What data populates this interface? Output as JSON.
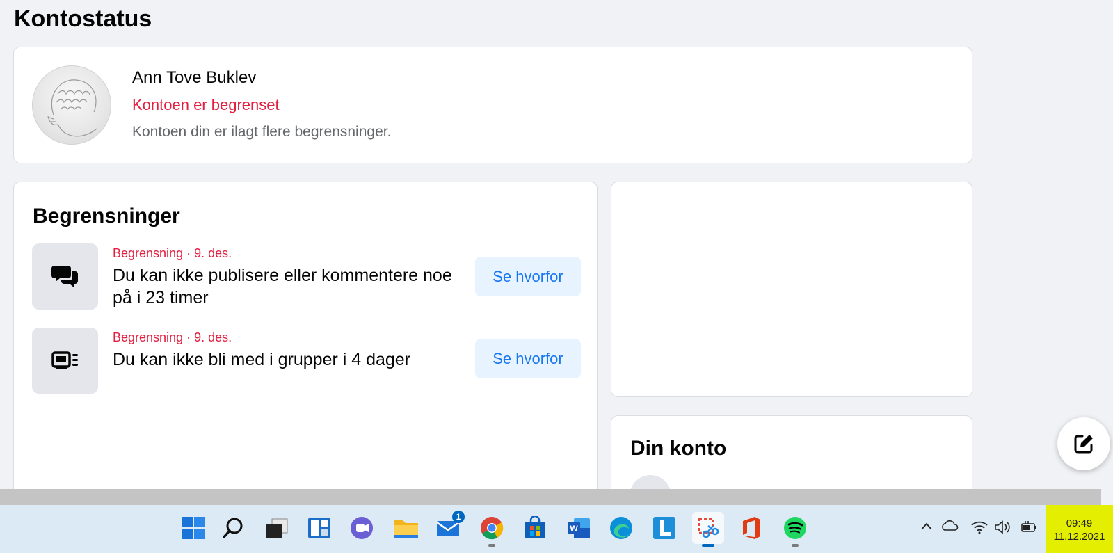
{
  "page": {
    "title": "Kontostatus"
  },
  "profile": {
    "name": "Ann Tove Buklev",
    "status": "Kontoen er begrenset",
    "description": "Kontoen din er ilagt flere begrensninger."
  },
  "restrictions": {
    "title": "Begrensninger",
    "items": [
      {
        "meta": "Begrensning · 9. des.",
        "text": "Du kan ikke publisere eller kommentere noe på i 23 timer",
        "button": "Se hvorfor",
        "icon": "chat-bubbles-icon"
      },
      {
        "meta": "Begrensning · 9. des.",
        "text": "Du kan ikke bli med i grupper i 4 dager",
        "button": "Se hvorfor",
        "icon": "groups-feed-icon"
      }
    ]
  },
  "account": {
    "title": "Din konto"
  },
  "taskbar": {
    "apps": [
      "windows-start",
      "search",
      "task-view",
      "widgets",
      "teams-chat",
      "file-explorer",
      "mail",
      "chrome",
      "microsoft-store",
      "word",
      "edge",
      "l-app",
      "snipping-tool",
      "office",
      "spotify"
    ],
    "mail_badge": "1",
    "clock_time": "09:49",
    "clock_date": "11.12.2021"
  },
  "colors": {
    "accent": "#1877f2",
    "alert": "#e41e3f",
    "muted": "#65676b",
    "clock_highlight": "#e3ee00"
  }
}
